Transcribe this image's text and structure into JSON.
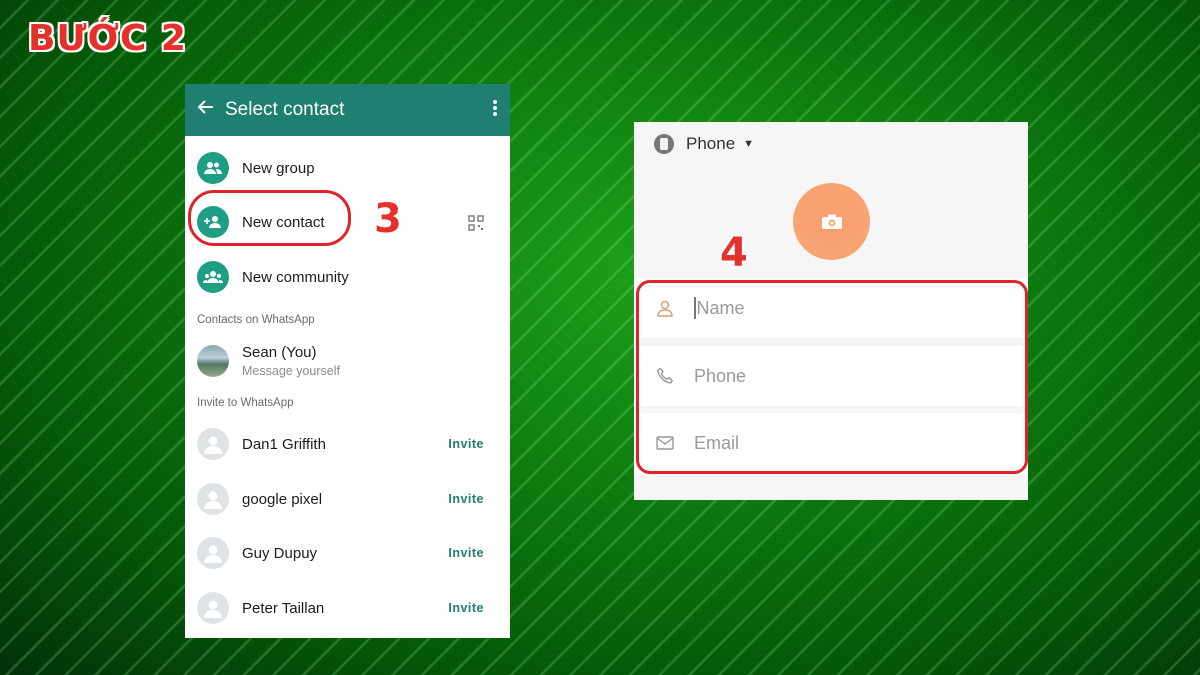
{
  "step_title": "BƯỚC 2",
  "step_markers": {
    "left": "3",
    "right": "4"
  },
  "left_screen": {
    "header": {
      "title": "Select contact",
      "back_icon": "arrow-left-icon",
      "menu_icon": "kebab-menu-icon"
    },
    "actions": [
      {
        "label": "New group",
        "icon": "group-icon"
      },
      {
        "label": "New contact",
        "icon": "add-person-icon"
      },
      {
        "label": "New community",
        "icon": "community-icon"
      }
    ],
    "section_contacts": "Contacts on WhatsApp",
    "self": {
      "name": "Sean (You)",
      "sub": "Message yourself"
    },
    "section_invite": "Invite to WhatsApp",
    "invite_label": "Invite",
    "invitees": [
      "Dan1 Griffith",
      "google pixel",
      "Guy Dupuy",
      "Peter Taillan"
    ],
    "accent": "#1f7f70"
  },
  "right_screen": {
    "account": {
      "label": "Phone",
      "icon": "phone-account-icon"
    },
    "photo_icon": "camera-icon",
    "fields": [
      {
        "placeholder": "Name",
        "icon": "person-icon"
      },
      {
        "placeholder": "Phone",
        "icon": "phone-icon"
      },
      {
        "placeholder": "Email",
        "icon": "mail-icon"
      }
    ],
    "avatar_color": "#f7a777"
  },
  "highlight_color": "#e0222a"
}
